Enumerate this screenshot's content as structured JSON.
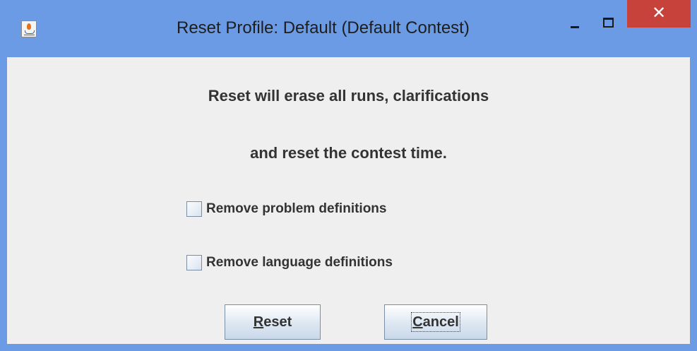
{
  "window": {
    "title": "Reset Profile: Default (Default Contest)",
    "icon": "java-icon",
    "controls": {
      "minimize": "minimize",
      "maximize": "maximize",
      "close": "✕"
    }
  },
  "message": {
    "line1": "Reset will erase all runs, clarifications",
    "line2": "and reset the contest time."
  },
  "options": [
    {
      "label": "Remove problem definitions",
      "checked": false
    },
    {
      "label": "Remove language definitions",
      "checked": false
    }
  ],
  "buttons": {
    "reset": {
      "mnemonic": "R",
      "rest": "eset"
    },
    "cancel": {
      "mnemonic": "C",
      "rest": "ancel"
    }
  },
  "colors": {
    "titlebar": "#6a9be4",
    "close_button": "#c7423a",
    "dialog_background": "#efefef"
  }
}
